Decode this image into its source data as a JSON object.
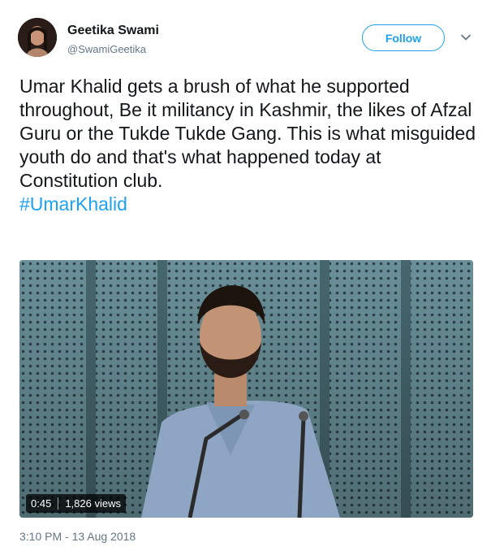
{
  "author": {
    "name": "Geetika Swami",
    "handle": "@SwamiGeetika"
  },
  "follow_label": "Follow",
  "tweet": {
    "text": "Umar Khalid gets a brush of what he supported throughout, Be it militancy in Kashmir, the likes of Afzal Guru or the  Tukde Tukde Gang. This is what misguided youth do and that's what happened today at Constitution club.",
    "hashtag": "#UmarKhalid"
  },
  "video": {
    "duration": "0:45",
    "views": "1,826 views"
  },
  "timestamp": "3:10 PM - 13 Aug 2018",
  "colors": {
    "accent": "#1da1f2",
    "muted": "#657786",
    "text": "#14171a"
  },
  "icons": [
    "avatar",
    "chevron-down-icon"
  ]
}
